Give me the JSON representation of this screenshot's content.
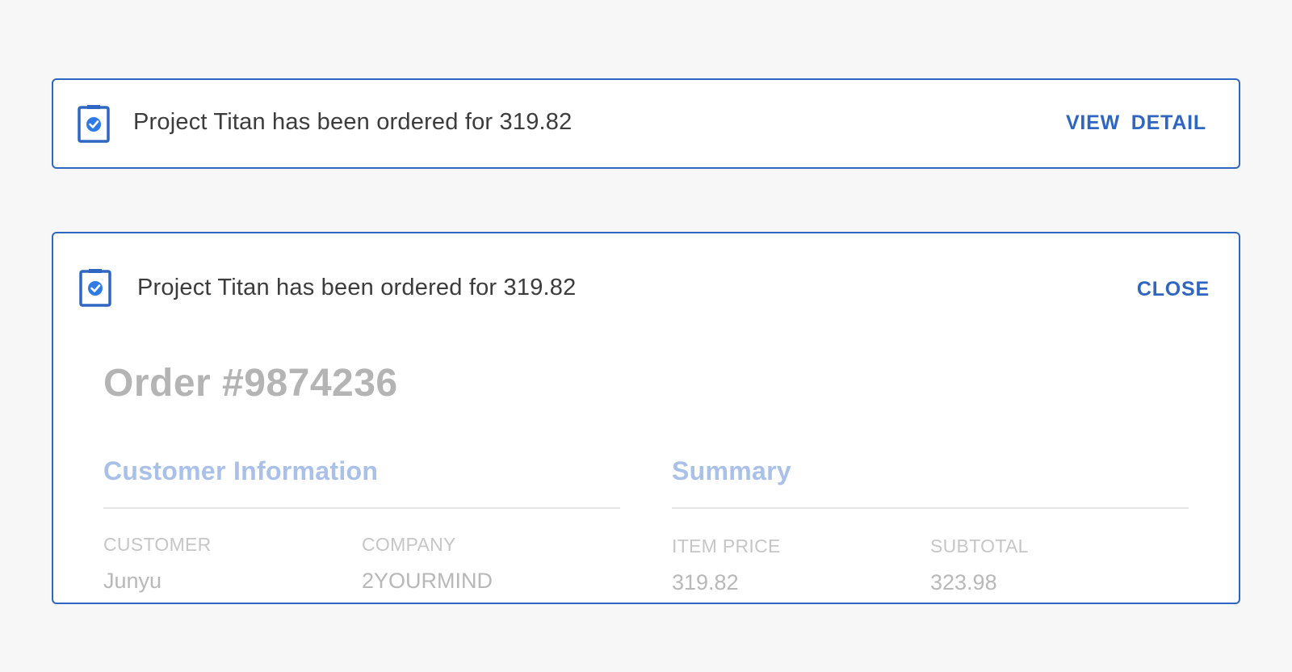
{
  "notification": {
    "message": "Project Titan has been ordered for 319.82",
    "view_detail_label": "VIEW  DETAIL",
    "icon": "clipboard-check-icon"
  },
  "detail": {
    "message": "Project Titan has been ordered for 319.82",
    "close_label": "CLOSE",
    "icon": "clipboard-check-icon",
    "order_title": "Order #9874236",
    "customer_info": {
      "title": "Customer Information",
      "fields": [
        {
          "label": "CUSTOMER",
          "value": "Junyu"
        },
        {
          "label": "COMPANY",
          "value": "2YOURMIND"
        }
      ]
    },
    "summary": {
      "title": "Summary",
      "fields": [
        {
          "label": "ITEM PRICE",
          "value": "319.82"
        },
        {
          "label": "SUBTOTAL",
          "value": "323.98"
        }
      ]
    }
  },
  "colors": {
    "accent": "#2f66c2",
    "check_circle": "#2f7be6",
    "background": "#f7f7f7",
    "section_title": "#a9c0e8"
  }
}
